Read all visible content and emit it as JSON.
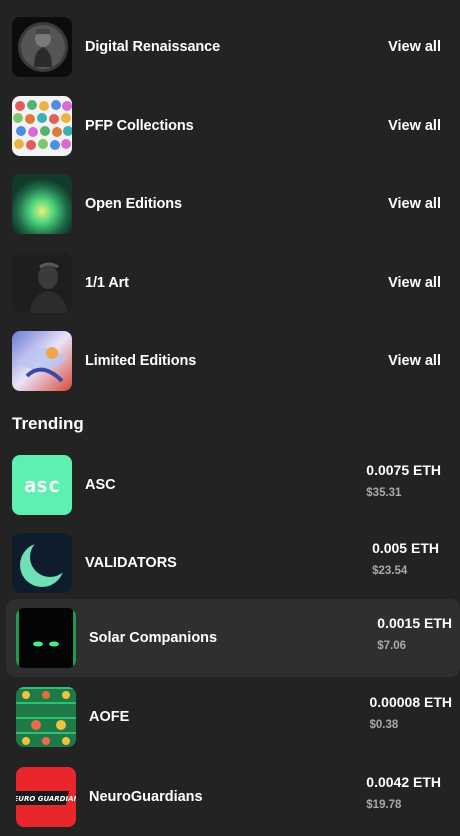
{
  "categories": [
    {
      "name": "Digital Renaissance",
      "action": "View all"
    },
    {
      "name": "PFP Collections",
      "action": "View all"
    },
    {
      "name": "Open Editions",
      "action": "View all"
    },
    {
      "name": "1/1 Art",
      "action": "View all"
    },
    {
      "name": "Limited Editions",
      "action": "View all"
    }
  ],
  "trending": {
    "title": "Trending",
    "items": [
      {
        "name": "ASC",
        "price_eth": "0.0075 ETH",
        "price_usd": "$35.31",
        "thumb_text": "asc"
      },
      {
        "name": "VALIDATORS",
        "price_eth": "0.005 ETH",
        "price_usd": "$23.54"
      },
      {
        "name": "Solar Companions",
        "price_eth": "0.0015 ETH",
        "price_usd": "$7.06"
      },
      {
        "name": "AOFE",
        "price_eth": "0.00008 ETH",
        "price_usd": "$0.38"
      },
      {
        "name": "NeuroGuardians",
        "price_eth": "0.0042 ETH",
        "price_usd": "$19.78",
        "thumb_text": "NEURO GUARDIANS"
      }
    ]
  },
  "colors": {
    "background": "#232323",
    "highlight_row": "#2f2f2f",
    "secondary_text": "#a9a9a9",
    "asc_green": "#5ef0b0",
    "neuro_red": "#e8262b"
  }
}
